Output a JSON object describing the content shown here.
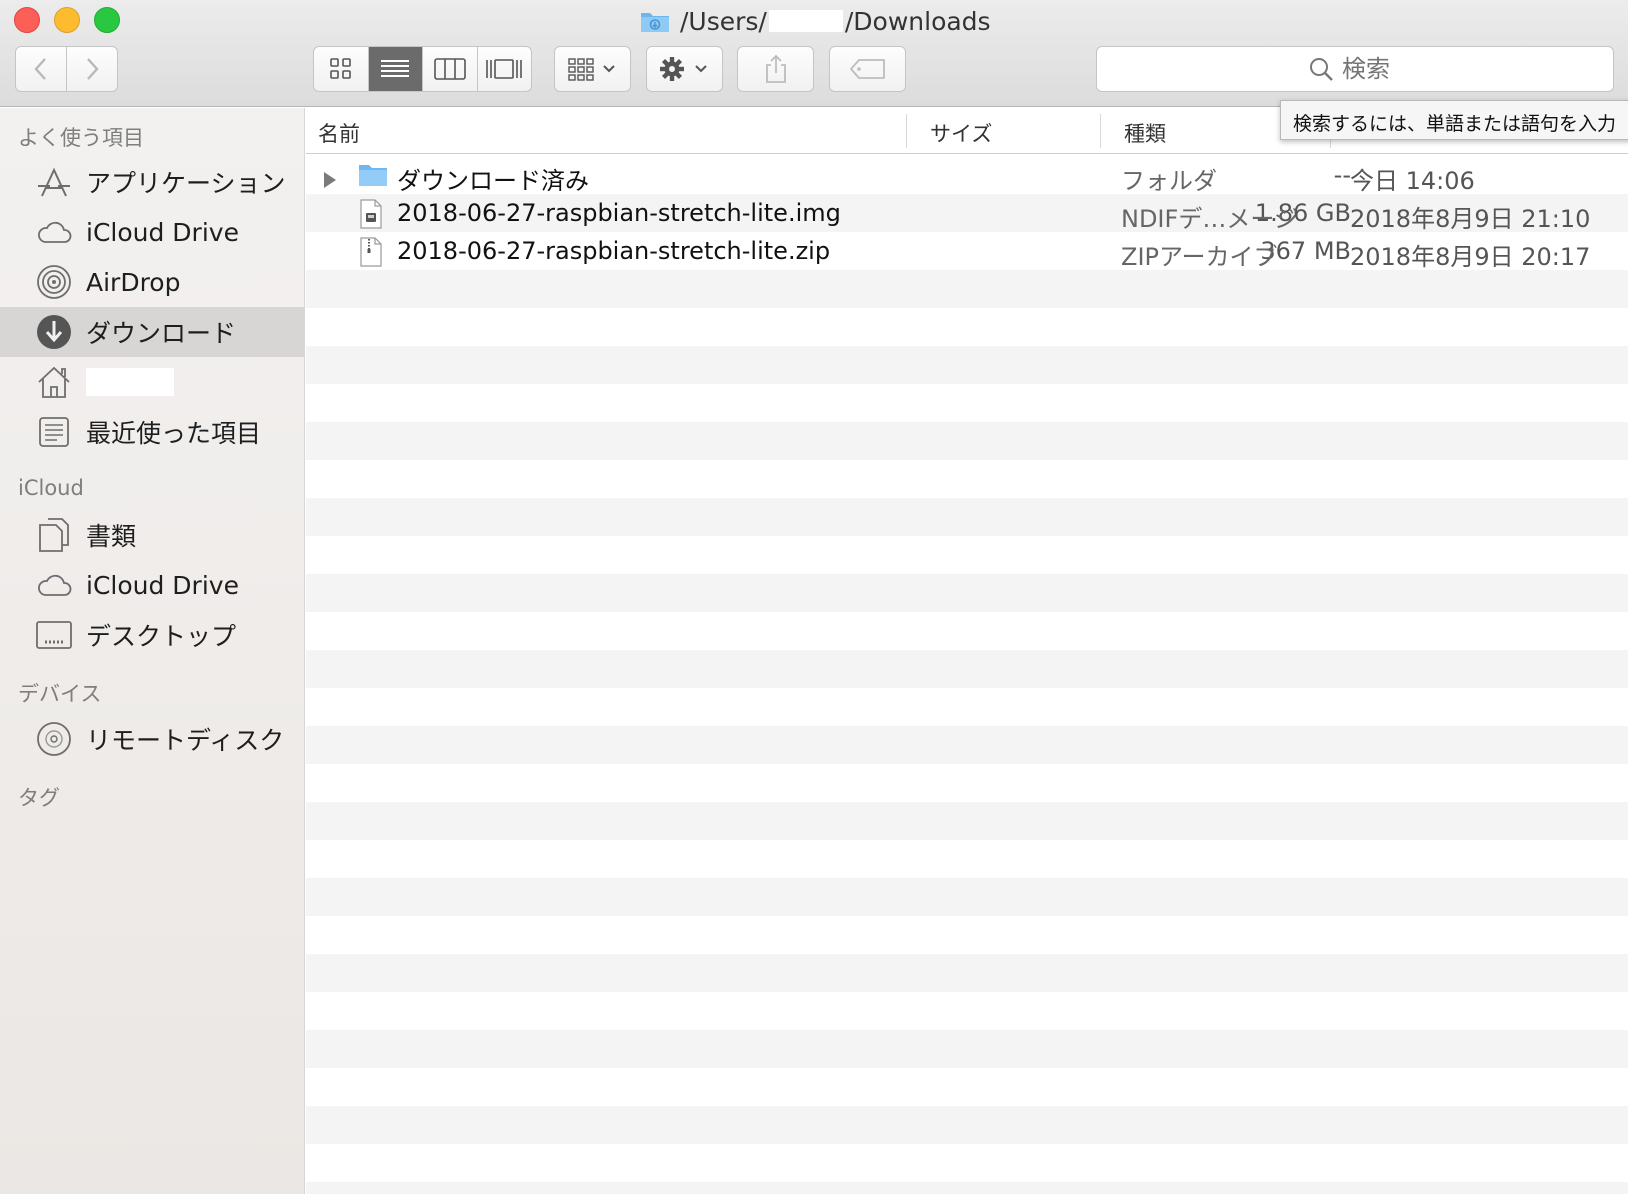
{
  "window": {
    "title_prefix": "/Users/",
    "title_suffix": "/Downloads"
  },
  "toolbar": {
    "search_placeholder": "検索"
  },
  "tooltip": "検索するには、単語または語句を入力",
  "sidebar": {
    "sections": {
      "favorites": "よく使う項目",
      "icloud": "iCloud",
      "devices": "デバイス",
      "tags": "タグ"
    },
    "favorites": [
      {
        "label": "アプリケーション",
        "icon": "applications-icon"
      },
      {
        "label": "iCloud Drive",
        "icon": "cloud-icon"
      },
      {
        "label": "AirDrop",
        "icon": "airdrop-icon"
      },
      {
        "label": "ダウンロード",
        "icon": "download-icon",
        "selected": true
      },
      {
        "label": "",
        "icon": "home-icon"
      },
      {
        "label": "最近使った項目",
        "icon": "recents-icon"
      }
    ],
    "icloud": [
      {
        "label": "書類",
        "icon": "documents-icon"
      },
      {
        "label": "iCloud Drive",
        "icon": "cloud-icon"
      },
      {
        "label": "デスクトップ",
        "icon": "desktop-icon"
      }
    ],
    "devices": [
      {
        "label": "リモートディスク",
        "icon": "disc-icon"
      }
    ]
  },
  "columns": {
    "name": "名前",
    "size": "サイズ",
    "kind": "種類"
  },
  "files": [
    {
      "name": "ダウンロード済み",
      "size": "--",
      "kind": "フォルダ",
      "date": "今日 14:06",
      "icon": "folder-icon"
    },
    {
      "name": "2018-06-27-raspbian-stretch-lite.img",
      "size": "1.86 GB",
      "kind": "NDIFデ…メージ",
      "date": "2018年8月9日 21:10",
      "icon": "disk-image-icon"
    },
    {
      "name": "2018-06-27-raspbian-stretch-lite.zip",
      "size": "367 MB",
      "kind": "ZIPアーカイブ",
      "date": "2018年8月9日 20:17",
      "icon": "zip-file-icon"
    }
  ]
}
